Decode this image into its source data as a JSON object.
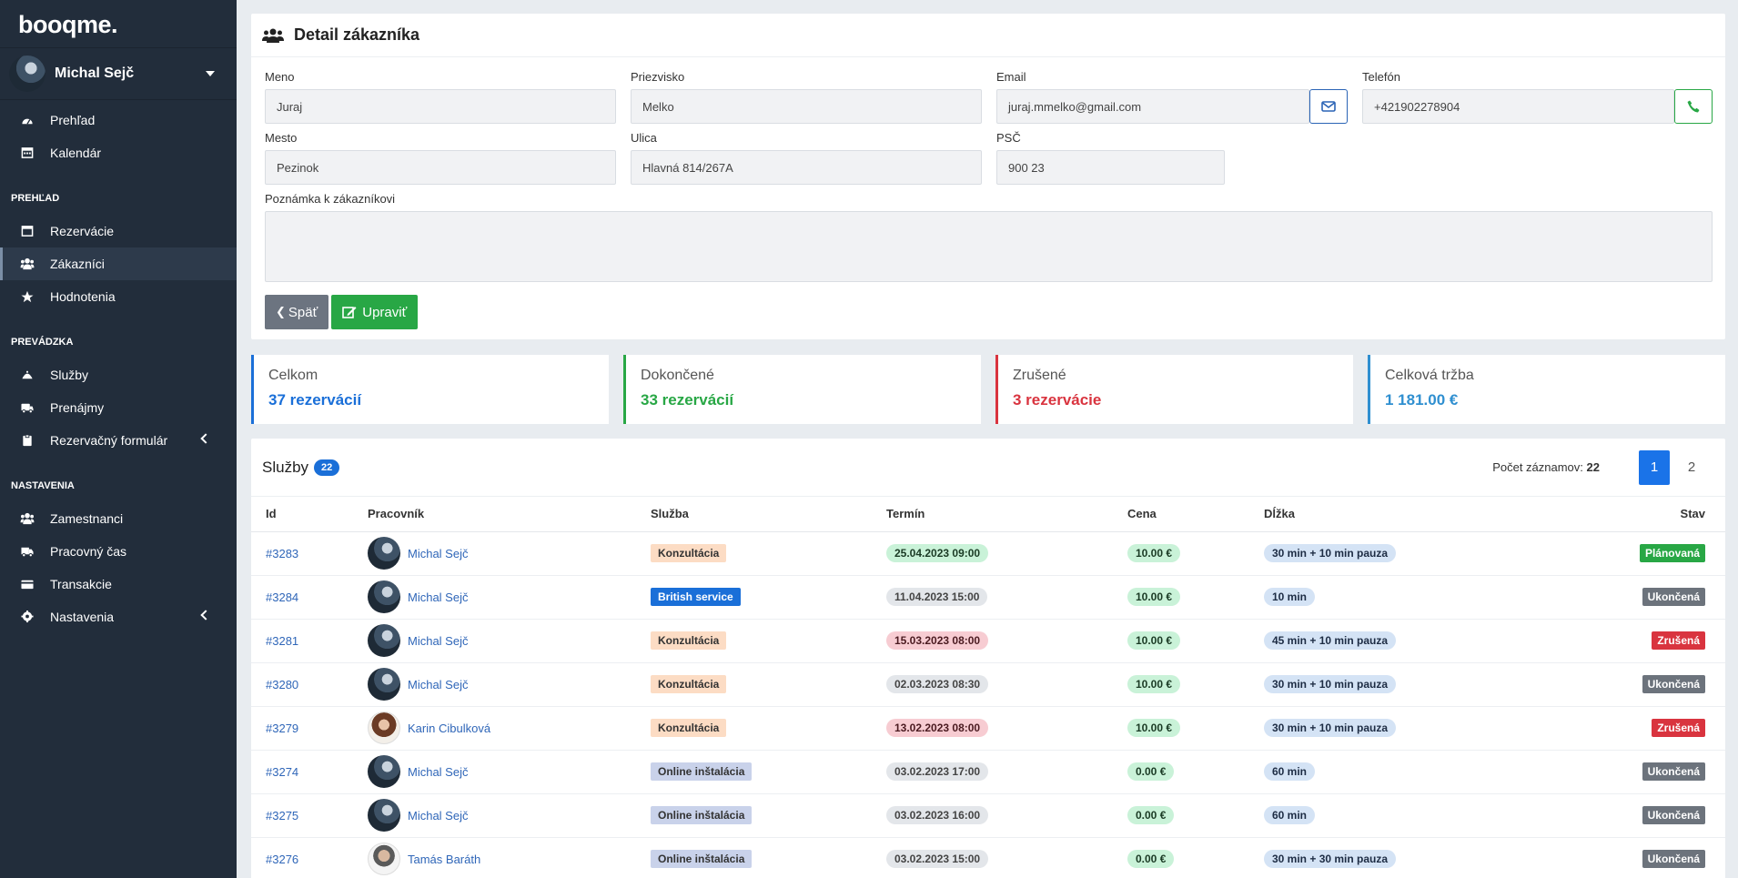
{
  "app": {
    "logo": "booqme."
  },
  "user": {
    "name": "Michal Sejč"
  },
  "sidebar": {
    "top_items": [
      {
        "label": "Prehľad",
        "icon": "dashboard-icon"
      },
      {
        "label": "Kalendár",
        "icon": "calendar-icon"
      }
    ],
    "sections": [
      {
        "heading": "PREHĽAD",
        "items": [
          {
            "label": "Rezervácie",
            "icon": "calendar-check-icon"
          },
          {
            "label": "Zákazníci",
            "icon": "users-icon",
            "active": true
          },
          {
            "label": "Hodnotenia",
            "icon": "star-icon"
          }
        ]
      },
      {
        "heading": "PREVÁDZKA",
        "items": [
          {
            "label": "Služby",
            "icon": "bell-icon"
          },
          {
            "label": "Prenájmy",
            "icon": "van-icon"
          },
          {
            "label": "Rezervačný formulár",
            "icon": "clipboard-icon",
            "submenu": true
          }
        ]
      },
      {
        "heading": "NASTAVENIA",
        "items": [
          {
            "label": "Zamestnanci",
            "icon": "users-icon"
          },
          {
            "label": "Pracovný čas",
            "icon": "truck-icon"
          },
          {
            "label": "Transakcie",
            "icon": "credit-card-icon"
          },
          {
            "label": "Nastavenia",
            "icon": "gear-icon",
            "submenu": true
          }
        ]
      }
    ]
  },
  "detail": {
    "title": "Detail zákazníka",
    "fields": {
      "meno": {
        "label": "Meno",
        "value": "Juraj"
      },
      "priezvisko": {
        "label": "Priezvisko",
        "value": "Melko"
      },
      "email": {
        "label": "Email",
        "value": "juraj.mmelko@gmail.com"
      },
      "telefon": {
        "label": "Telefón",
        "value": "+421902278904"
      },
      "mesto": {
        "label": "Mesto",
        "value": "Pezinok"
      },
      "ulica": {
        "label": "Ulica",
        "value": "Hlavná 814/267A"
      },
      "psc": {
        "label": "PSČ",
        "value": "900 23"
      },
      "poznamka": {
        "label": "Poznámka k zákazníkovi",
        "value": ""
      }
    },
    "buttons": {
      "back": "Späť",
      "edit": "Upraviť"
    }
  },
  "stats": [
    {
      "title": "Celkom",
      "value": "37 rezervácií",
      "color": "#1a6fd8"
    },
    {
      "title": "Dokončené",
      "value": "33 rezervácií",
      "color": "#28a745"
    },
    {
      "title": "Zrušené",
      "value": "3 rezervácie",
      "color": "#d9343f"
    },
    {
      "title": "Celková tržba",
      "value": "1 181.00 €",
      "color": "#2f8fd0"
    }
  ],
  "services": {
    "title": "Služby",
    "count": "22",
    "records_label": "Počet záznamov:",
    "records_count": "22",
    "pages": [
      "1",
      "2"
    ],
    "current_page": "1",
    "columns": [
      "Id",
      "Pracovník",
      "Služba",
      "Termín",
      "Cena",
      "Dĺžka",
      "Stav"
    ],
    "rows": [
      {
        "id": "#3283",
        "worker": "Michal Sejč",
        "avatar": "m",
        "service": "Konzultácia",
        "service_type": "konz",
        "term": "25.04.2023 09:00",
        "term_type": "green",
        "price": "10.00 €",
        "length": "30 min + 10 min pauza",
        "status": "Plánovaná",
        "status_type": "plan"
      },
      {
        "id": "#3284",
        "worker": "Michal Sejč",
        "avatar": "m",
        "service": "British service",
        "service_type": "brit",
        "term": "11.04.2023 15:00",
        "term_type": "grey",
        "price": "10.00 €",
        "length": "10 min",
        "status": "Ukončená",
        "status_type": "ukon"
      },
      {
        "id": "#3281",
        "worker": "Michal Sejč",
        "avatar": "m",
        "service": "Konzultácia",
        "service_type": "konz",
        "term": "15.03.2023 08:00",
        "term_type": "red",
        "price": "10.00 €",
        "length": "45 min + 10 min pauza",
        "status": "Zrušená",
        "status_type": "zrus"
      },
      {
        "id": "#3280",
        "worker": "Michal Sejč",
        "avatar": "m",
        "service": "Konzultácia",
        "service_type": "konz",
        "term": "02.03.2023 08:30",
        "term_type": "grey",
        "price": "10.00 €",
        "length": "30 min + 10 min pauza",
        "status": "Ukončená",
        "status_type": "ukon"
      },
      {
        "id": "#3279",
        "worker": "Karin Cibulková",
        "avatar": "k",
        "service": "Konzultácia",
        "service_type": "konz",
        "term": "13.02.2023 08:00",
        "term_type": "red",
        "price": "10.00 €",
        "length": "30 min + 10 min pauza",
        "status": "Zrušená",
        "status_type": "zrus"
      },
      {
        "id": "#3274",
        "worker": "Michal Sejč",
        "avatar": "m",
        "service": "Online inštalácia",
        "service_type": "online",
        "term": "03.02.2023 17:00",
        "term_type": "grey",
        "price": "0.00 €",
        "length": "60 min",
        "status": "Ukončená",
        "status_type": "ukon"
      },
      {
        "id": "#3275",
        "worker": "Michal Sejč",
        "avatar": "m",
        "service": "Online inštalácia",
        "service_type": "online",
        "term": "03.02.2023 16:00",
        "term_type": "grey",
        "price": "0.00 €",
        "length": "60 min",
        "status": "Ukončená",
        "status_type": "ukon"
      },
      {
        "id": "#3276",
        "worker": "Tamás Baráth",
        "avatar": "t",
        "service": "Online inštalácia",
        "service_type": "online",
        "term": "03.02.2023 15:00",
        "term_type": "grey",
        "price": "0.00 €",
        "length": "30 min + 30 min pauza",
        "status": "Ukončená",
        "status_type": "ukon"
      }
    ]
  }
}
